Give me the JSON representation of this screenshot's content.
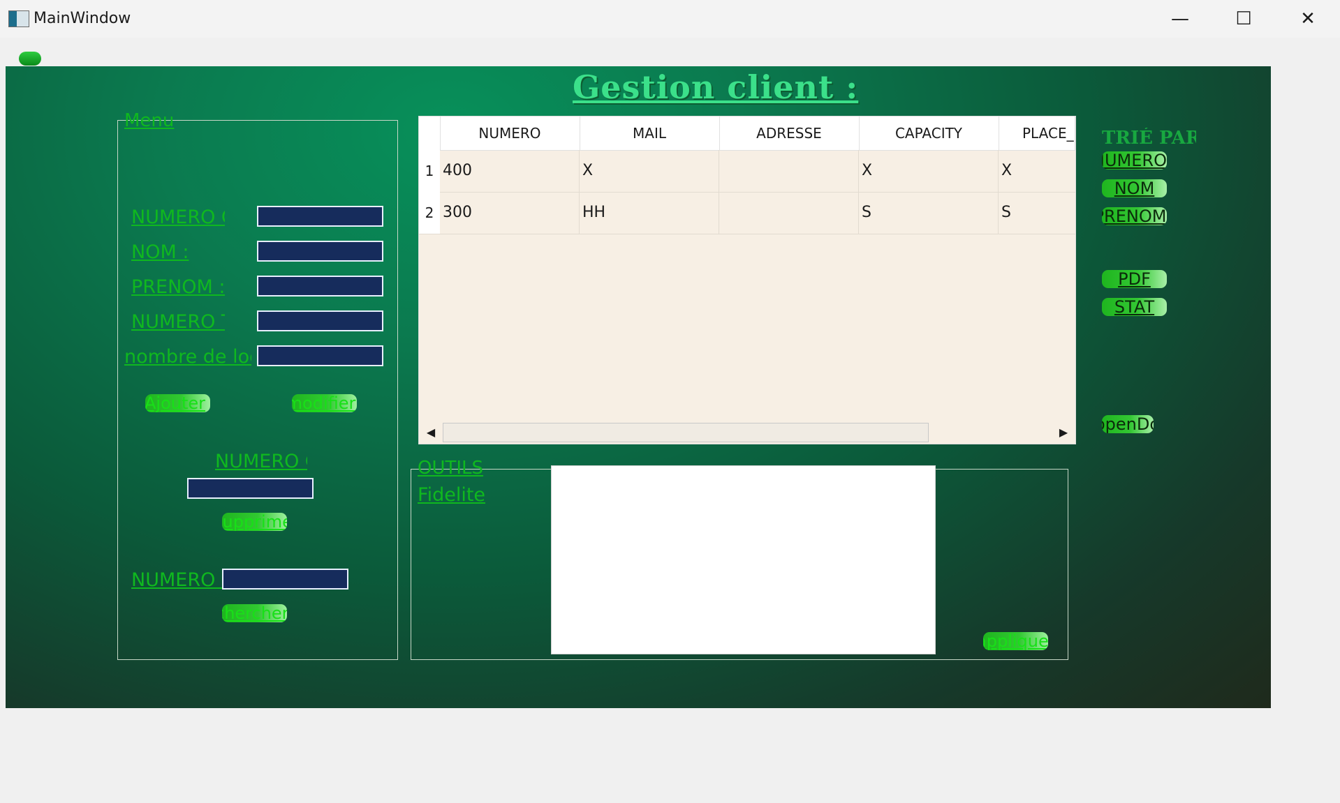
{
  "window": {
    "title": "MainWindow",
    "minimize_glyph": "—",
    "maximize_glyph": "☐",
    "close_glyph": "✕"
  },
  "page_title": "Gestion client :",
  "menu": {
    "legend": "Menu",
    "fields": [
      {
        "label": "NUMERO C"
      },
      {
        "label": "NOM :"
      },
      {
        "label": "PRENOM :"
      },
      {
        "label": "NUMERO T"
      },
      {
        "label": "nombre de loc"
      }
    ],
    "ajouter_label": "Ajouter",
    "modifier_label": "modifier",
    "delete_label": "NUMERO C",
    "supprimer_label": "supprimer",
    "search_label": "NUMERO C",
    "chercher_label": "chercher"
  },
  "table": {
    "columns": [
      "NUMERO",
      "MAIL",
      "ADRESSE",
      "CAPACITY",
      "PLACE_I"
    ],
    "rows": [
      {
        "index": "1",
        "cells": [
          "400",
          "X",
          "",
          "X",
          "X"
        ]
      },
      {
        "index": "2",
        "cells": [
          "300",
          "HH",
          "",
          "S",
          "S"
        ]
      }
    ],
    "scroll_left": "◀",
    "scroll_right": "▶"
  },
  "sort_panel": {
    "title": "TRIÉ PAR",
    "buttons": [
      "NUMERO C",
      "NOM",
      "PRENOM"
    ],
    "pdf_label": "PDF",
    "stat_label": "STAT",
    "opendoc_label": "openDoc"
  },
  "outils": {
    "legend": "OUTILS",
    "fidelite_label": "Fidelite",
    "appliquer_label": "appliquer"
  },
  "colors": {
    "accent_green": "#0fb81f",
    "title_green": "#3be08a",
    "input_navy": "#162c5c",
    "table_bg": "#f7efe4"
  }
}
